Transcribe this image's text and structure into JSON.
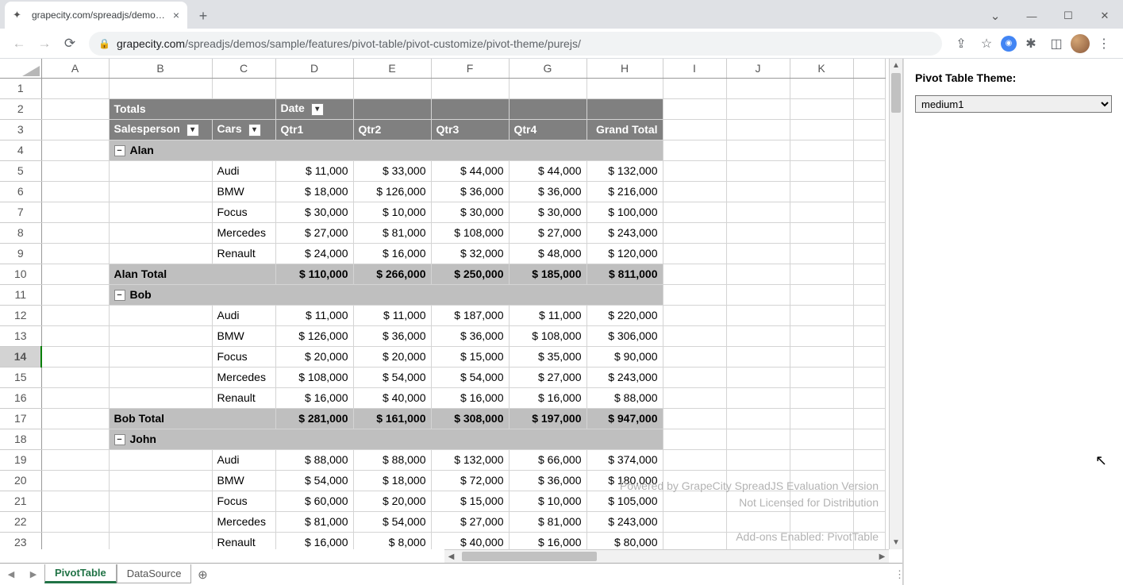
{
  "browser": {
    "tab_title": "grapecity.com/spreadjs/demos/s",
    "url_host": "grapecity.com",
    "url_path": "/spreadjs/demos/sample/features/pivot-table/pivot-customize/pivot-theme/purejs/"
  },
  "panel": {
    "label": "Pivot Table Theme:",
    "selected": "medium1"
  },
  "columns": [
    "A",
    "B",
    "C",
    "D",
    "E",
    "F",
    "G",
    "H",
    "I",
    "J",
    "K"
  ],
  "pivot": {
    "totals_label": "Totals",
    "date_label": "Date",
    "salesperson_label": "Salesperson",
    "cars_label": "Cars",
    "qtr_labels": [
      "Qtr1",
      "Qtr2",
      "Qtr3",
      "Qtr4"
    ],
    "grand_total_label": "Grand Total",
    "groups": [
      {
        "name": "Alan",
        "rows": [
          {
            "car": "Audi",
            "v": [
              "$ 11,000",
              "$ 33,000",
              "$ 44,000",
              "$ 44,000",
              "$ 132,000"
            ]
          },
          {
            "car": "BMW",
            "v": [
              "$ 18,000",
              "$ 126,000",
              "$ 36,000",
              "$ 36,000",
              "$ 216,000"
            ]
          },
          {
            "car": "Focus",
            "v": [
              "$ 30,000",
              "$ 10,000",
              "$ 30,000",
              "$ 30,000",
              "$ 100,000"
            ]
          },
          {
            "car": "Mercedes",
            "v": [
              "$ 27,000",
              "$ 81,000",
              "$ 108,000",
              "$ 27,000",
              "$ 243,000"
            ]
          },
          {
            "car": "Renault",
            "v": [
              "$ 24,000",
              "$ 16,000",
              "$ 32,000",
              "$ 48,000",
              "$ 120,000"
            ]
          }
        ],
        "total_label": "Alan Total",
        "total": [
          "$ 110,000",
          "$ 266,000",
          "$ 250,000",
          "$ 185,000",
          "$ 811,000"
        ]
      },
      {
        "name": "Bob",
        "rows": [
          {
            "car": "Audi",
            "v": [
              "$ 11,000",
              "$ 11,000",
              "$ 187,000",
              "$ 11,000",
              "$ 220,000"
            ]
          },
          {
            "car": "BMW",
            "v": [
              "$ 126,000",
              "$ 36,000",
              "$ 36,000",
              "$ 108,000",
              "$ 306,000"
            ]
          },
          {
            "car": "Focus",
            "v": [
              "$ 20,000",
              "$ 20,000",
              "$ 15,000",
              "$ 35,000",
              "$ 90,000"
            ]
          },
          {
            "car": "Mercedes",
            "v": [
              "$ 108,000",
              "$ 54,000",
              "$ 54,000",
              "$ 27,000",
              "$ 243,000"
            ]
          },
          {
            "car": "Renault",
            "v": [
              "$ 16,000",
              "$ 40,000",
              "$ 16,000",
              "$ 16,000",
              "$ 88,000"
            ]
          }
        ],
        "total_label": "Bob Total",
        "total": [
          "$ 281,000",
          "$ 161,000",
          "$ 308,000",
          "$ 197,000",
          "$ 947,000"
        ]
      },
      {
        "name": "John",
        "rows": [
          {
            "car": "Audi",
            "v": [
              "$ 88,000",
              "$ 88,000",
              "$ 132,000",
              "$ 66,000",
              "$ 374,000"
            ]
          },
          {
            "car": "BMW",
            "v": [
              "$ 54,000",
              "$ 18,000",
              "$ 72,000",
              "$ 36,000",
              "$ 180,000"
            ]
          },
          {
            "car": "Focus",
            "v": [
              "$ 60,000",
              "$ 20,000",
              "$ 15,000",
              "$ 10,000",
              "$ 105,000"
            ]
          },
          {
            "car": "Mercedes",
            "v": [
              "$ 81,000",
              "$ 54,000",
              "$ 27,000",
              "$ 81,000",
              "$ 243,000"
            ]
          },
          {
            "car": "Renault",
            "v": [
              "$ 16,000",
              "$ 8,000",
              "$ 40,000",
              "$ 16,000",
              "$ 80,000"
            ]
          }
        ]
      }
    ]
  },
  "watermark": {
    "line1": "Powered by GrapeCity SpreadJS Evaluation Version",
    "line2": "Not Licensed for Distribution",
    "line3": "Add-ons Enabled: PivotTable"
  },
  "sheet_tabs": [
    "PivotTable",
    "DataSource"
  ],
  "row_count": 23,
  "selected_row": 14
}
